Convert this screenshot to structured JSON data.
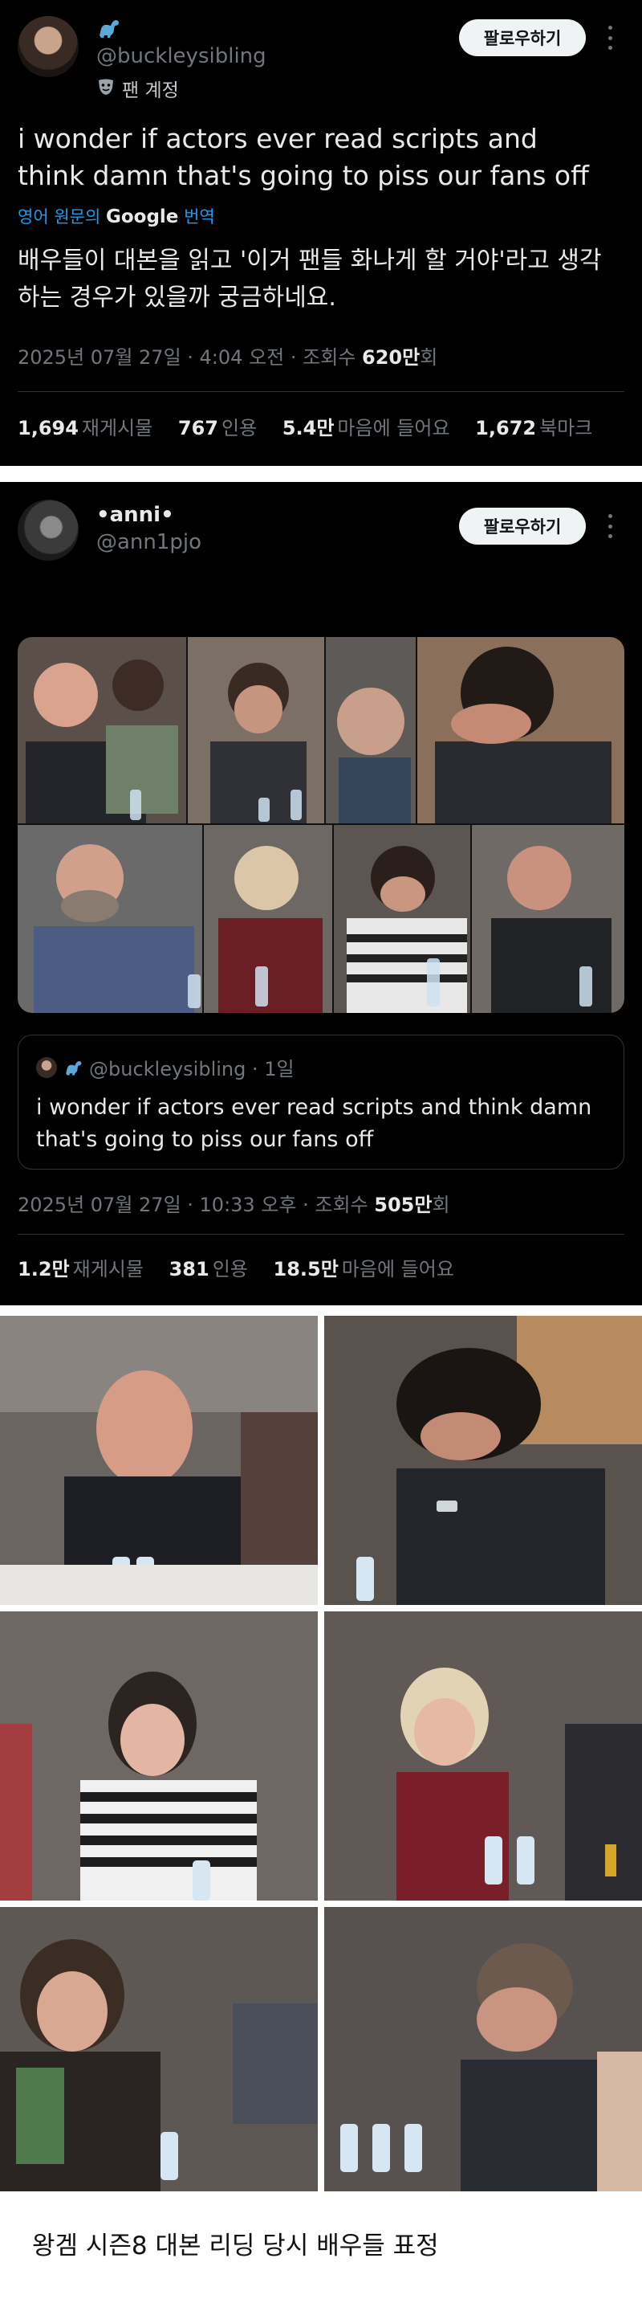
{
  "tweet1": {
    "handle": "@buckleysibling",
    "account_type": "팬 계정",
    "follow_label": "팔로우하기",
    "text": "i wonder if actors ever read scripts and think damn that's going to piss our fans off",
    "translate_prefix": "영어 원문의",
    "translate_brand": "Google",
    "translate_suffix": "번역",
    "translation": "배우들이 대본을 읽고 '이거 팬들 화나게 할 거야'라고 생각하는 경우가 있을까 궁금하네요.",
    "timestamp": "2025년 07월 27일 · 4:04 오전 · 조회수",
    "views": "620만",
    "views_suffix": "회",
    "stats": [
      {
        "value": "1,694",
        "label": "재게시물"
      },
      {
        "value": "767",
        "label": "인용"
      },
      {
        "value": "5.4만",
        "label": "마음에 들어요"
      },
      {
        "value": "1,672",
        "label": "북마크"
      }
    ]
  },
  "tweet2": {
    "name": "•anni•",
    "handle": "@ann1pjo",
    "follow_label": "팔로우하기",
    "quote": {
      "handle": "@buckleysibling · 1일",
      "text": "i wonder if actors ever read scripts and think damn that's going to piss our fans off"
    },
    "timestamp": "2025년 07월 27일 · 10:33 오후 · 조회수",
    "views": "505만",
    "views_suffix": "회",
    "stats": [
      {
        "value": "1.2만",
        "label": "재게시물"
      },
      {
        "value": "381",
        "label": "인용"
      },
      {
        "value": "18.5만",
        "label": "마음에 들어요"
      }
    ]
  },
  "caption": "왕겜 시즌8 대본 리딩 당시 배우들 표정",
  "icons": {
    "more": "more-dots-icon",
    "dino": "dinosaur-emoji-icon",
    "mask": "theater-mask-icon"
  },
  "colors": {
    "background": "#000000",
    "text": "#e7e9ea",
    "muted": "#71767b",
    "link": "#1d9bf0",
    "button_bg": "#eff3f4"
  }
}
